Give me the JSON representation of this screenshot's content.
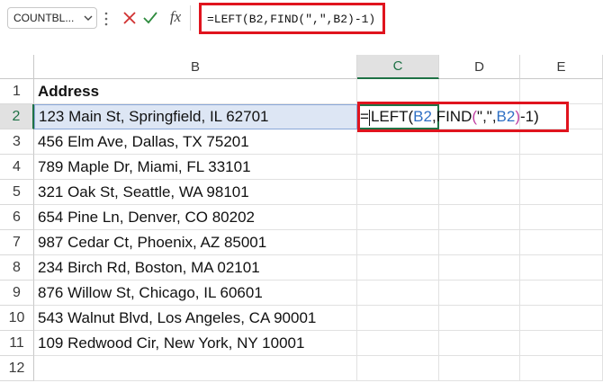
{
  "name_box": {
    "value": "COUNTBL...",
    "dropdown_icon": "chevron-down-icon"
  },
  "formula_bar": {
    "cancel_icon": "close-icon",
    "enter_icon": "checkmark-icon",
    "fx_label": "fx",
    "formula": "=LEFT(B2,FIND(\",\",B2)-1)",
    "highlight_color": "#e0141e"
  },
  "columns": [
    "B",
    "C",
    "D",
    "E"
  ],
  "active_column": "C",
  "rows": [
    "1",
    "2",
    "3",
    "4",
    "5",
    "6",
    "7",
    "8",
    "9",
    "10",
    "11",
    "12"
  ],
  "active_row": "2",
  "cells": {
    "B1": "Address",
    "B2": "123 Main St, Springfield, IL 62701",
    "B3": "456 Elm Ave, Dallas, TX 75201",
    "B4": "789 Maple Dr, Miami, FL 33101",
    "B5": "321 Oak St, Seattle, WA 98101",
    "B6": "654 Pine Ln, Denver, CO 80202",
    "B7": "987 Cedar Ct, Phoenix, AZ 85001",
    "B8": "234 Birch Rd, Boston, MA 02101",
    "B9": "876 Willow St, Chicago, IL 60601",
    "B10": "543 Walnut Blvd, Los Angeles, CA 90001",
    "B11": "109 Redwood Cir, New York, NY 10001"
  },
  "editing_cell": {
    "ref": "C2",
    "tokens": {
      "eq": "=",
      "fn1": "LEFT(",
      "ref1": "B2",
      "mid": ",FIND",
      "open": "(",
      "comma_arg": "\",\",",
      "ref2": "B2",
      "close": ")",
      "tail": "-1)"
    }
  },
  "colors": {
    "accent_green": "#1e7145",
    "ref_blue": "#2e6fc4",
    "paren_magenta": "#c03fa3",
    "selection_fill": "#dde6f4"
  }
}
